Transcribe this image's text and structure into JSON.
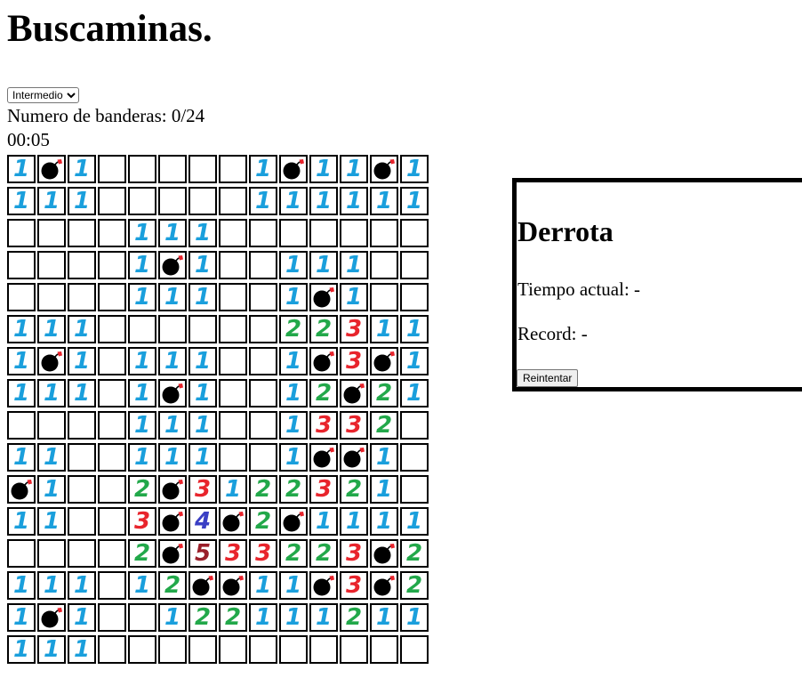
{
  "title": "Buscaminas.",
  "difficulty": {
    "selected": "Intermedio"
  },
  "flags": {
    "label": "Numero de banderas: 0/24"
  },
  "timer": "00:05",
  "board": [
    [
      "1",
      "M",
      "1",
      "",
      "",
      "",
      "",
      "",
      "1",
      "M",
      "1",
      "1",
      "M",
      "1"
    ],
    [
      "1",
      "1",
      "1",
      "",
      "",
      "",
      "",
      "",
      "1",
      "1",
      "1",
      "1",
      "1",
      "1"
    ],
    [
      "",
      "",
      "",
      "",
      "1",
      "1",
      "1",
      "",
      "",
      "",
      "",
      "",
      "",
      ""
    ],
    [
      "",
      "",
      "",
      "",
      "1",
      "M",
      "1",
      "",
      "",
      "1",
      "1",
      "1",
      "",
      ""
    ],
    [
      "",
      "",
      "",
      "",
      "1",
      "1",
      "1",
      "",
      "",
      "1",
      "M",
      "1",
      "",
      ""
    ],
    [
      "1",
      "1",
      "1",
      "",
      "",
      "",
      "",
      "",
      "",
      "2",
      "2",
      "3",
      "1",
      "1"
    ],
    [
      "1",
      "M",
      "1",
      "",
      "1",
      "1",
      "1",
      "",
      "",
      "1",
      "M",
      "3",
      "M",
      "1"
    ],
    [
      "1",
      "1",
      "1",
      "",
      "1",
      "M",
      "1",
      "",
      "",
      "1",
      "2",
      "M",
      "2",
      "1"
    ],
    [
      "",
      "",
      "",
      "",
      "1",
      "1",
      "1",
      "",
      "",
      "1",
      "3",
      "3",
      "2",
      ""
    ],
    [
      "1",
      "1",
      "",
      "",
      "1",
      "1",
      "1",
      "",
      "",
      "1",
      "M",
      "M",
      "1",
      ""
    ],
    [
      "M",
      "1",
      "",
      "",
      "2",
      "M",
      "3",
      "1",
      "2",
      "2",
      "3",
      "2",
      "1",
      ""
    ],
    [
      "1",
      "1",
      "",
      "",
      "3",
      "M",
      "4",
      "M",
      "2",
      "M",
      "1",
      "1",
      "1",
      "1"
    ],
    [
      "",
      "",
      "",
      "",
      "2",
      "M",
      "5",
      "3",
      "3",
      "2",
      "2",
      "3",
      "M",
      "2"
    ],
    [
      "1",
      "1",
      "1",
      "",
      "1",
      "2",
      "M",
      "M",
      "1",
      "1",
      "M",
      "3",
      "M",
      "2"
    ],
    [
      "1",
      "M",
      "1",
      "",
      "",
      "1",
      "2",
      "2",
      "1",
      "1",
      "1",
      "2",
      "1",
      "1"
    ],
    [
      "1",
      "1",
      "1",
      "",
      "",
      "",
      "",
      "",
      "",
      "",
      "",
      "",
      "",
      ""
    ]
  ],
  "number_colors": {
    "1": "#1a9fdc",
    "2": "#22a84a",
    "3": "#e8242c",
    "4": "#3a3fc4",
    "5": "#9a1f2a"
  },
  "mine_icon": "bomb-icon",
  "result": {
    "heading": "Derrota",
    "current_time": "Tiempo actual: -",
    "record": "Record: -",
    "retry_label": "Reintentar"
  }
}
